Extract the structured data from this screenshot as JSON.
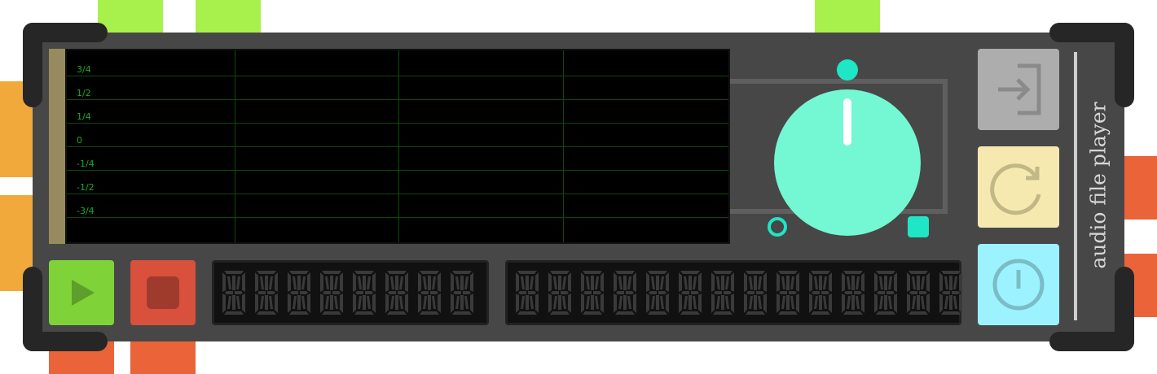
{
  "module": {
    "title": "audio file player"
  },
  "scope": {
    "y_labels": [
      "3/4",
      "1/2",
      "1/4",
      "0",
      "-1/4",
      "-1/2",
      "-3/4"
    ]
  },
  "knob": {
    "name": "gain-knob",
    "color": "#74f7d3",
    "min_marker": "ring",
    "max_marker": "square"
  },
  "buttons": {
    "play": {
      "icon": "play-icon",
      "color": "#7fd338"
    },
    "stop": {
      "icon": "stop-icon",
      "color": "#d9503d"
    },
    "load": {
      "icon": "enter-icon",
      "color": "#adadad"
    },
    "loop": {
      "icon": "loop-icon",
      "color": "#f6e9b0"
    },
    "power": {
      "icon": "power-icon",
      "color": "#9cf3ff"
    }
  },
  "displays": {
    "position_digits": 8,
    "filename_digits": 14
  },
  "ports": {
    "top": [
      "port-top-1",
      "port-top-2",
      "port-top-3"
    ],
    "left": [
      "port-left-1",
      "port-left-2"
    ],
    "right": [
      "port-right-1",
      "port-right-2"
    ],
    "bottom": [
      "port-bottom-1",
      "port-bottom-2"
    ]
  },
  "colors": {
    "panel": "#474747",
    "port_green": "#a8f04c",
    "port_orange": "#f2a93b",
    "port_red": "#ea6339",
    "scope_grid": "#0c4a0c",
    "scope_text": "#1fa91f"
  }
}
